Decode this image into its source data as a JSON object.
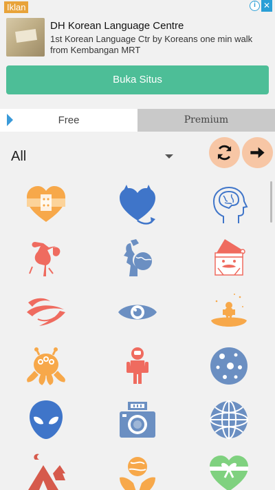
{
  "ad": {
    "badge": "Iklan",
    "title": "DH Korean Language Centre",
    "description": "1st Korean Language Ctr by Koreans one min walk from Kembangan MRT",
    "button_label": "Buka Situs",
    "close": "✕",
    "info": "i"
  },
  "tabs": [
    {
      "label": "Free",
      "active": true
    },
    {
      "label": "Premium",
      "active": false
    }
  ],
  "filter": {
    "selected": "All"
  },
  "colors": {
    "orange": "#f7a84a",
    "blue": "#3f75c9",
    "red": "#ef6b5f",
    "green": "#7fd17f",
    "slate": "#6b8fc2",
    "accent": "#4dbe97"
  },
  "icons": [
    {
      "name": "bandaged-heart-icon"
    },
    {
      "name": "devil-heart-icon"
    },
    {
      "name": "brain-head-icon"
    },
    {
      "name": "stork-baby-icon"
    },
    {
      "name": "globe-head-icon"
    },
    {
      "name": "santa-icon"
    },
    {
      "name": "swirl-icon"
    },
    {
      "name": "eye-icon"
    },
    {
      "name": "astronaut-planet-icon"
    },
    {
      "name": "alien-octopus-icon"
    },
    {
      "name": "astronaut-icon"
    },
    {
      "name": "moon-icon"
    },
    {
      "name": "alien-head-icon"
    },
    {
      "name": "camera-icon"
    },
    {
      "name": "globe-icon"
    },
    {
      "name": "tent-camp-icon"
    },
    {
      "name": "globe-hands-icon"
    },
    {
      "name": "gift-heart-icon"
    }
  ]
}
